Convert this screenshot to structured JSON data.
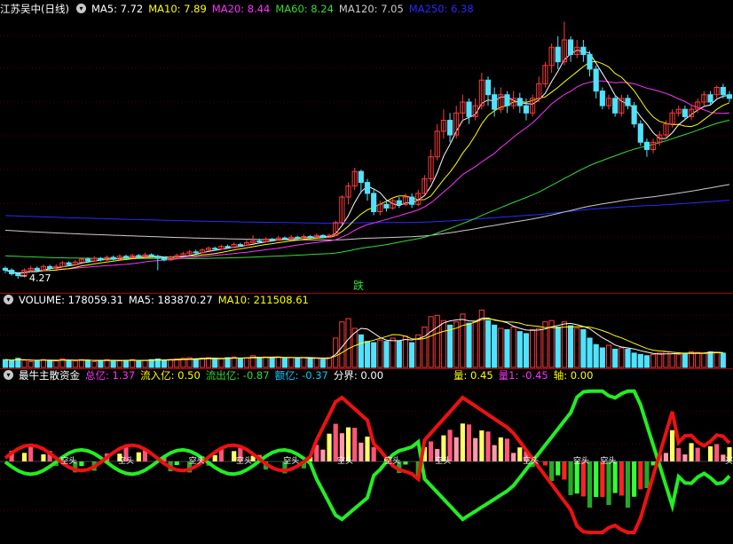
{
  "colors": {
    "up": "#ff3b3b",
    "down": "#4fe3ff",
    "ma5": "#ffffff",
    "ma10": "#ffff00",
    "ma20": "#ff33ff",
    "ma60": "#33dd33",
    "ma120": "#cccccc",
    "ma250": "#2a2aff",
    "divider": "#aa0000"
  },
  "panel1": {
    "title": "江苏吴中(日线)",
    "control_icon": "chevron-down-icon",
    "ma": [
      {
        "label": "MA5: 7.72",
        "color": "#ffffff"
      },
      {
        "label": "MA10: 7.89",
        "color": "#ffff00"
      },
      {
        "label": "MA20: 8.44",
        "color": "#ff33ff"
      },
      {
        "label": "MA60: 8.24",
        "color": "#33dd33"
      },
      {
        "label": "MA120: 7.05",
        "color": "#cccccc"
      },
      {
        "label": "MA250: 6.38",
        "color": "#2a2aff"
      }
    ],
    "low_label": "4.27",
    "signal_label": "跌"
  },
  "panel2": {
    "items": [
      {
        "label": "VOLUME: 178059.31",
        "color": "#ffffff"
      },
      {
        "label": "MA5: 183870.27",
        "color": "#ffffff"
      },
      {
        "label": "MA10: 211508.61",
        "color": "#ffff00"
      }
    ]
  },
  "panel3": {
    "items": [
      {
        "label": "最牛主散资金",
        "color": "#ffffff"
      },
      {
        "label": "总亿: 1.37",
        "color": "#ff33ff"
      },
      {
        "label": "流入亿: 0.50",
        "color": "#ffff00"
      },
      {
        "label": "流出亿: -0.87",
        "color": "#33dd33"
      },
      {
        "label": "额亿: -0.37",
        "color": "#00ccff"
      },
      {
        "label": "分界: 0.00",
        "color": "#ffffff"
      }
    ],
    "items_right": [
      {
        "label": "量: 0.45",
        "color": "#ffff00"
      },
      {
        "label": "量1: -0.45",
        "color": "#ff33ff"
      },
      {
        "label": "轴: 0.00",
        "color": "#ffff00"
      }
    ],
    "marker_text": "空头",
    "marker_text_2": "买"
  },
  "chart_data": {
    "type": "candlestick",
    "price_marks": {
      "low": 4.27
    },
    "candles": [
      [
        4.55,
        4.5,
        4.6,
        4.42
      ],
      [
        4.5,
        4.4,
        4.55,
        4.35
      ],
      [
        4.4,
        4.35,
        4.45,
        4.27
      ],
      [
        4.35,
        4.5,
        4.55,
        4.3
      ],
      [
        4.5,
        4.55,
        4.62,
        4.45
      ],
      [
        4.55,
        4.5,
        4.6,
        4.45
      ],
      [
        4.5,
        4.6,
        4.65,
        4.48
      ],
      [
        4.6,
        4.55,
        4.65,
        4.5
      ],
      [
        4.55,
        4.6,
        4.66,
        4.52
      ],
      [
        4.6,
        4.7,
        4.75,
        4.57
      ],
      [
        4.7,
        4.65,
        4.74,
        4.6
      ],
      [
        4.65,
        4.72,
        4.78,
        4.62
      ],
      [
        4.72,
        4.8,
        4.85,
        4.7
      ],
      [
        4.8,
        4.75,
        4.85,
        4.7
      ],
      [
        4.75,
        4.82,
        4.88,
        4.72
      ],
      [
        4.82,
        4.78,
        4.86,
        4.74
      ],
      [
        4.78,
        4.85,
        4.9,
        4.75
      ],
      [
        4.85,
        4.8,
        4.9,
        4.77
      ],
      [
        4.8,
        4.88,
        4.93,
        4.78
      ],
      [
        4.88,
        4.84,
        4.92,
        4.8
      ],
      [
        4.84,
        4.9,
        4.95,
        4.82
      ],
      [
        4.9,
        4.86,
        4.94,
        4.83
      ],
      [
        4.86,
        4.92,
        4.98,
        4.84
      ],
      [
        4.92,
        4.88,
        4.96,
        4.85
      ],
      [
        4.88,
        4.84,
        4.92,
        4.5
      ],
      [
        4.84,
        4.78,
        4.86,
        4.74
      ],
      [
        4.78,
        4.85,
        4.9,
        4.76
      ],
      [
        4.85,
        4.9,
        4.95,
        4.82
      ],
      [
        4.9,
        4.95,
        5.0,
        4.88
      ],
      [
        4.95,
        5.0,
        5.05,
        4.92
      ],
      [
        5.0,
        4.98,
        5.06,
        4.95
      ],
      [
        4.98,
        5.05,
        5.1,
        4.96
      ],
      [
        5.05,
        5.1,
        5.15,
        5.02
      ],
      [
        5.1,
        5.08,
        5.14,
        5.04
      ],
      [
        5.08,
        5.15,
        5.2,
        5.06
      ],
      [
        5.15,
        5.12,
        5.2,
        5.08
      ],
      [
        5.12,
        5.2,
        5.26,
        5.1
      ],
      [
        5.2,
        5.18,
        5.25,
        5.14
      ],
      [
        5.18,
        5.25,
        5.35,
        5.16
      ],
      [
        5.25,
        5.3,
        5.45,
        5.22
      ],
      [
        5.3,
        5.28,
        5.36,
        5.24
      ],
      [
        5.28,
        5.35,
        5.4,
        5.25
      ],
      [
        5.35,
        5.32,
        5.38,
        5.28
      ],
      [
        5.32,
        5.38,
        5.44,
        5.3
      ],
      [
        5.38,
        5.36,
        5.42,
        5.32
      ],
      [
        5.36,
        5.4,
        5.46,
        5.33
      ],
      [
        5.4,
        5.38,
        5.44,
        5.35
      ],
      [
        5.38,
        5.42,
        5.48,
        5.36
      ],
      [
        5.42,
        5.4,
        5.46,
        5.37
      ],
      [
        5.4,
        5.45,
        5.5,
        5.38
      ],
      [
        5.45,
        5.4,
        5.48,
        5.37
      ],
      [
        5.4,
        5.45,
        5.5,
        5.38
      ],
      [
        5.45,
        5.8,
        5.85,
        5.43
      ],
      [
        5.8,
        6.5,
        6.55,
        5.75
      ],
      [
        6.5,
        6.8,
        6.9,
        6.3
      ],
      [
        6.8,
        7.2,
        7.3,
        6.7
      ],
      [
        7.2,
        6.9,
        7.25,
        6.6
      ],
      [
        6.9,
        6.6,
        7.0,
        6.4
      ],
      [
        6.6,
        6.1,
        6.7,
        6.0
      ],
      [
        6.1,
        6.3,
        6.4,
        6.0
      ],
      [
        6.3,
        6.2,
        6.4,
        6.1
      ],
      [
        6.2,
        6.4,
        6.5,
        6.15
      ],
      [
        6.4,
        6.3,
        6.5,
        6.2
      ],
      [
        6.3,
        6.5,
        6.6,
        6.25
      ],
      [
        6.5,
        6.3,
        6.6,
        6.2
      ],
      [
        6.3,
        6.6,
        6.7,
        6.25
      ],
      [
        6.6,
        7.0,
        7.1,
        6.55
      ],
      [
        7.0,
        7.6,
        7.8,
        6.9
      ],
      [
        7.6,
        8.3,
        8.5,
        7.5
      ],
      [
        8.3,
        8.6,
        8.9,
        8.1
      ],
      [
        8.6,
        8.2,
        8.8,
        8.0
      ],
      [
        8.2,
        8.8,
        9.0,
        8.1
      ],
      [
        8.8,
        9.1,
        9.3,
        8.6
      ],
      [
        9.1,
        8.7,
        9.2,
        8.5
      ],
      [
        8.7,
        9.0,
        9.2,
        8.6
      ],
      [
        9.0,
        9.7,
        9.9,
        8.9
      ],
      [
        9.7,
        9.3,
        9.8,
        9.0
      ],
      [
        9.3,
        8.9,
        9.5,
        8.7
      ],
      [
        8.9,
        9.3,
        9.5,
        8.8
      ],
      [
        9.3,
        9.0,
        9.4,
        8.8
      ],
      [
        9.0,
        9.2,
        9.4,
        8.9
      ],
      [
        9.2,
        9.0,
        9.35,
        8.8
      ],
      [
        9.0,
        8.8,
        9.2,
        8.6
      ],
      [
        8.8,
        9.2,
        9.3,
        8.7
      ],
      [
        9.2,
        9.6,
        9.8,
        9.1
      ],
      [
        9.6,
        10.1,
        10.2,
        9.5
      ],
      [
        10.1,
        10.6,
        10.7,
        9.9
      ],
      [
        10.6,
        10.2,
        10.9,
        10.0
      ],
      [
        10.2,
        10.8,
        11.3,
        10.1
      ],
      [
        10.8,
        10.4,
        10.9,
        10.2
      ],
      [
        10.4,
        10.6,
        10.8,
        10.3
      ],
      [
        10.6,
        10.4,
        10.8,
        10.2
      ],
      [
        10.4,
        10.0,
        10.5,
        9.8
      ],
      [
        10.0,
        9.4,
        10.1,
        9.2
      ],
      [
        9.4,
        9.0,
        9.5,
        8.9
      ],
      [
        9.0,
        9.2,
        9.3,
        8.9
      ],
      [
        9.2,
        8.8,
        9.3,
        8.7
      ],
      [
        8.8,
        9.2,
        9.3,
        8.7
      ],
      [
        9.2,
        9.0,
        9.3,
        8.9
      ],
      [
        9.0,
        8.5,
        9.1,
        8.4
      ],
      [
        8.5,
        8.0,
        8.6,
        7.9
      ],
      [
        8.0,
        7.8,
        8.1,
        7.6
      ],
      [
        7.8,
        8.0,
        8.1,
        7.7
      ],
      [
        8.0,
        8.2,
        8.3,
        7.9
      ],
      [
        8.2,
        8.5,
        8.6,
        8.1
      ],
      [
        8.5,
        8.8,
        8.9,
        8.4
      ],
      [
        8.8,
        8.9,
        9.0,
        8.7
      ],
      [
        8.9,
        8.7,
        9.0,
        8.6
      ],
      [
        8.7,
        8.9,
        9.0,
        8.6
      ],
      [
        8.9,
        9.1,
        9.2,
        8.8
      ],
      [
        9.1,
        9.3,
        9.4,
        9.0
      ],
      [
        9.3,
        9.1,
        9.4,
        9.0
      ],
      [
        9.3,
        9.5,
        9.55,
        9.2
      ],
      [
        9.5,
        9.3,
        9.6,
        9.2
      ],
      [
        9.3,
        9.2,
        9.4,
        9.1
      ]
    ],
    "volume": [
      12,
      10,
      14,
      11,
      9,
      10,
      12,
      11,
      10,
      13,
      11,
      10,
      12,
      11,
      9,
      10,
      12,
      11,
      10,
      11,
      12,
      10,
      11,
      12,
      13,
      11,
      12,
      13,
      14,
      15,
      13,
      14,
      15,
      14,
      13,
      15,
      16,
      14,
      15,
      18,
      15,
      16,
      15,
      16,
      14,
      15,
      14,
      15,
      13,
      14,
      12,
      15,
      45,
      70,
      75,
      60,
      50,
      40,
      38,
      42,
      40,
      45,
      40,
      48,
      38,
      50,
      62,
      78,
      80,
      72,
      65,
      70,
      82,
      68,
      70,
      88,
      72,
      65,
      60,
      58,
      62,
      55,
      52,
      58,
      60,
      70,
      72,
      62,
      70,
      64,
      60,
      58,
      45,
      35,
      30,
      34,
      28,
      30,
      28,
      22,
      20,
      18,
      20,
      22,
      24,
      21,
      20,
      22,
      24,
      23,
      22,
      24,
      23,
      22
    ]
  }
}
